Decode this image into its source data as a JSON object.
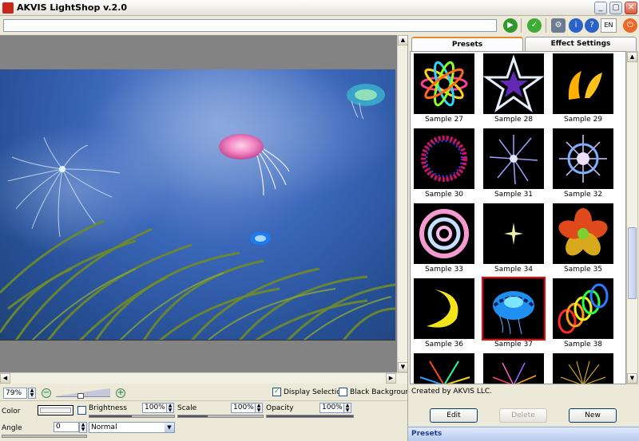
{
  "window": {
    "title": "AKVIS LightShop v.2.0"
  },
  "toolbar": {
    "path_value": "",
    "language": "EN"
  },
  "zoom": {
    "value": "79%"
  },
  "options": {
    "display_selection": "Display Selection",
    "black_background": "Black Background"
  },
  "effect": {
    "color_label": "Color",
    "brightness_label": "Brightness",
    "brightness_value": "100%",
    "scale_label": "Scale",
    "scale_value": "100%",
    "opacity_label": "Opacity",
    "opacity_value": "100%",
    "angle_label": "Angle",
    "angle_value": "0",
    "blend_mode": "Normal"
  },
  "tabs": [
    {
      "label": "Presets"
    },
    {
      "label": "Effect Settings"
    }
  ],
  "presets": [
    {
      "label": "Sample 27"
    },
    {
      "label": "Sample 28"
    },
    {
      "label": "Sample 29"
    },
    {
      "label": "Sample 30"
    },
    {
      "label": "Sample 31"
    },
    {
      "label": "Sample 32"
    },
    {
      "label": "Sample 33"
    },
    {
      "label": "Sample 34"
    },
    {
      "label": "Sample 35"
    },
    {
      "label": "Sample 36"
    },
    {
      "label": "Sample 37"
    },
    {
      "label": "Sample 38"
    }
  ],
  "info": {
    "text": "Created by AKVIS LLC."
  },
  "buttons": {
    "edit": "Edit",
    "delete": "Delete",
    "new": "New"
  },
  "footer": {
    "label": "Presets"
  }
}
